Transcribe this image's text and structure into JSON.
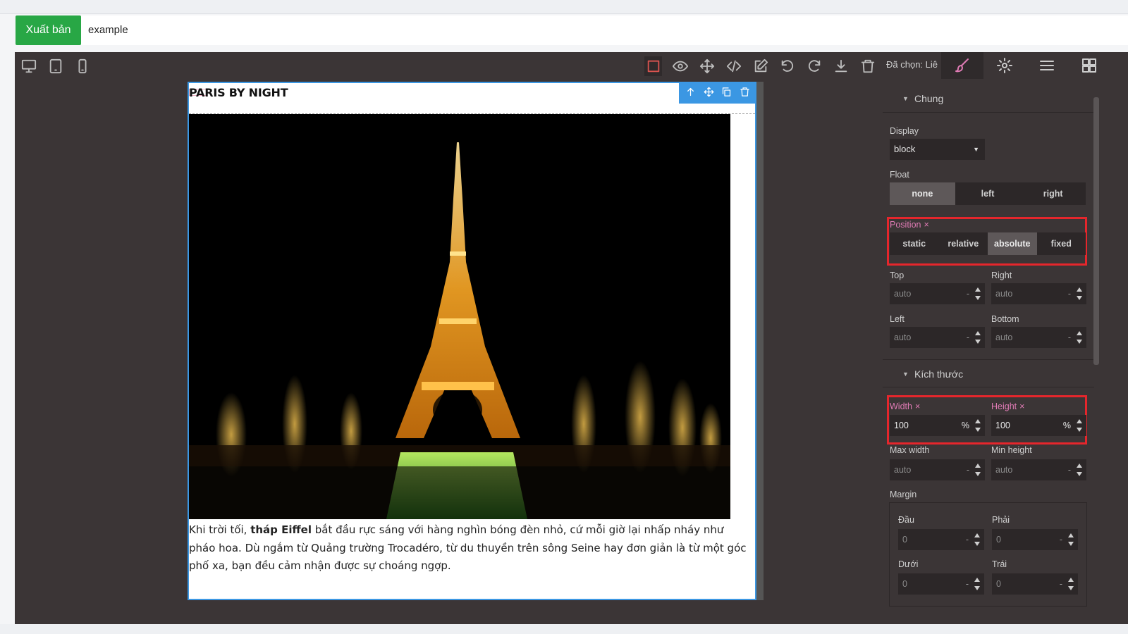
{
  "header": {
    "publish_label": "Xuất bản",
    "project_name": "example"
  },
  "toolbar": {
    "devices": [
      "desktop-icon",
      "tablet-icon",
      "mobile-icon"
    ],
    "commands": [
      "square-outline-icon",
      "eye-icon",
      "move-icon",
      "code-icon",
      "edit-icon",
      "undo-icon",
      "redo-icon",
      "download-icon",
      "trash-icon"
    ],
    "selected_label": "Đã chọn:",
    "selected_name": "Liê",
    "view_tabs": [
      "brush-icon",
      "gear-icon",
      "layers-icon",
      "blocks-icon"
    ]
  },
  "canvas": {
    "title": "PARIS BY NIGHT",
    "mini_toolbar": [
      "arrow-up-icon",
      "move-icon",
      "copy-icon",
      "trash-icon"
    ],
    "image_alt": "Eiffel Tower at night",
    "description_pre": "Khi trời tối, ",
    "description_bold": "tháp Eiffel",
    "description_post": " bắt đầu rực sáng với hàng nghìn bóng đèn nhỏ, cứ mỗi giờ lại nhấp nháy như pháo hoa. Dù ngắm từ Quảng trường Trocadéro, từ du thuyền trên sông Seine hay đơn giản là từ một góc phố xa, bạn đều cảm nhận được sự choáng ngợp."
  },
  "panel": {
    "general": {
      "title": "Chung",
      "display_label": "Display",
      "display_value": "block",
      "float_label": "Float",
      "float_options": [
        "none",
        "left",
        "right"
      ],
      "float_selected": "none",
      "position_label": "Position",
      "position_options": [
        "static",
        "relative",
        "absolute",
        "fixed"
      ],
      "position_selected": "absolute",
      "top_label": "Top",
      "top_value": "auto",
      "top_unit": "-",
      "right_label": "Right",
      "right_value": "auto",
      "right_unit": "-",
      "left_label": "Left",
      "left_value": "auto",
      "left_unit": "-",
      "bottom_label": "Bottom",
      "bottom_value": "auto",
      "bottom_unit": "-"
    },
    "dimension": {
      "title": "Kích thước",
      "width_label": "Width",
      "width_value": "100",
      "width_unit": "%",
      "height_label": "Height",
      "height_value": "100",
      "height_unit": "%",
      "maxwidth_label": "Max width",
      "maxwidth_value": "auto",
      "maxwidth_unit": "-",
      "minheight_label": "Min height",
      "minheight_value": "auto",
      "minheight_unit": "-",
      "margin_label": "Margin",
      "margin_top_label": "Đầu",
      "margin_top_value": "0",
      "margin_top_unit": "-",
      "margin_right_label": "Phải",
      "margin_right_value": "0",
      "margin_right_unit": "-",
      "margin_bottom_label": "Dưới",
      "margin_bottom_value": "0",
      "margin_bottom_unit": "-",
      "margin_left_label": "Trái",
      "margin_left_value": "0",
      "margin_left_unit": "-"
    },
    "close_mark": "×"
  },
  "colors": {
    "publish": "#28a745",
    "editor_bg": "#3b3536",
    "selection": "#3b97e3",
    "highlight": "#e5262c",
    "accent": "#e07bb5"
  }
}
